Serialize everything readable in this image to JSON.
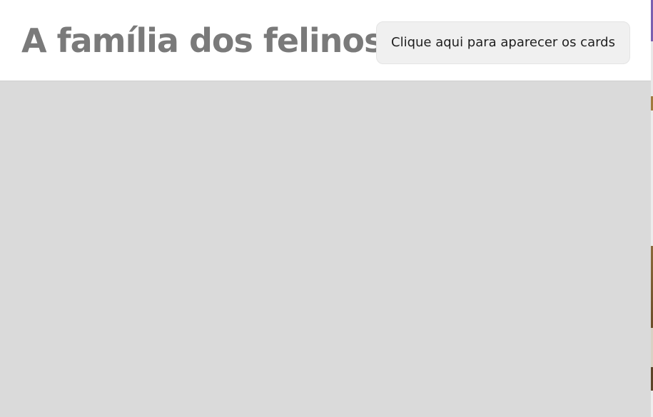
{
  "header": {
    "title": "A família dos felinos",
    "button_label": "Clique aqui para aparecer os cards"
  },
  "colors": {
    "title": "#7a7a7a",
    "button_background": "#f0f0f0",
    "content_background": "#dadada"
  }
}
